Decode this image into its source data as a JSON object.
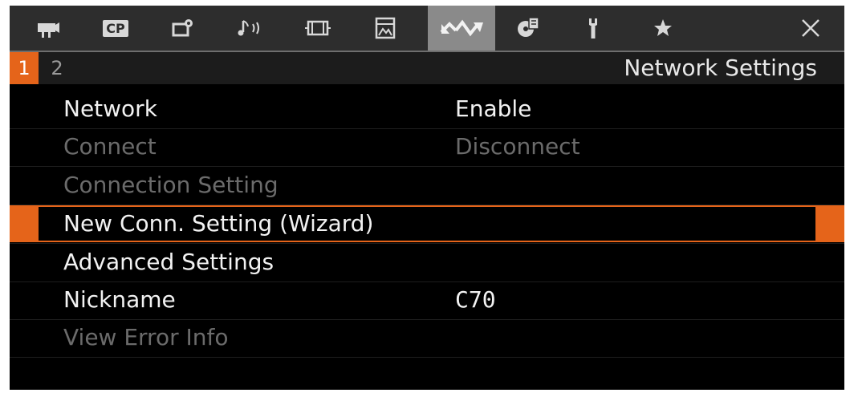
{
  "tabs": [
    {
      "icon": "movie-camera-icon"
    },
    {
      "icon": "cp-custom-picture-icon",
      "label": "CP"
    },
    {
      "icon": "camera-setup-icon"
    },
    {
      "icon": "audio-setup-icon"
    },
    {
      "icon": "video-setup-icon"
    },
    {
      "icon": "lcd-vf-setup-icon"
    },
    {
      "icon": "network-icon",
      "active": true
    },
    {
      "icon": "recording-media-icon"
    },
    {
      "icon": "system-setup-wrench-icon"
    },
    {
      "icon": "my-menu-star-icon"
    },
    {
      "icon": "close-icon",
      "label": "✕"
    }
  ],
  "pages": {
    "current": "1",
    "other": "2"
  },
  "title": "Network Settings",
  "menu": [
    {
      "label": "Network",
      "value": "Enable",
      "state": "enabled"
    },
    {
      "label": "Connect",
      "value": "Disconnect",
      "state": "disabled"
    },
    {
      "label": "Connection Setting",
      "value": "",
      "state": "disabled"
    },
    {
      "label": "New Conn. Setting (Wizard)",
      "value": "",
      "state": "selected"
    },
    {
      "label": "Advanced Settings",
      "value": "",
      "state": "enabled"
    },
    {
      "label": "Nickname",
      "value": "C70",
      "state": "enabled"
    },
    {
      "label": "View Error Info",
      "value": "",
      "state": "disabled"
    }
  ],
  "colors": {
    "accent": "#e5641a",
    "tabbar": "#2d2d2d",
    "active_tab": "#8a8a8a",
    "disabled_text": "#6b6b6b"
  }
}
